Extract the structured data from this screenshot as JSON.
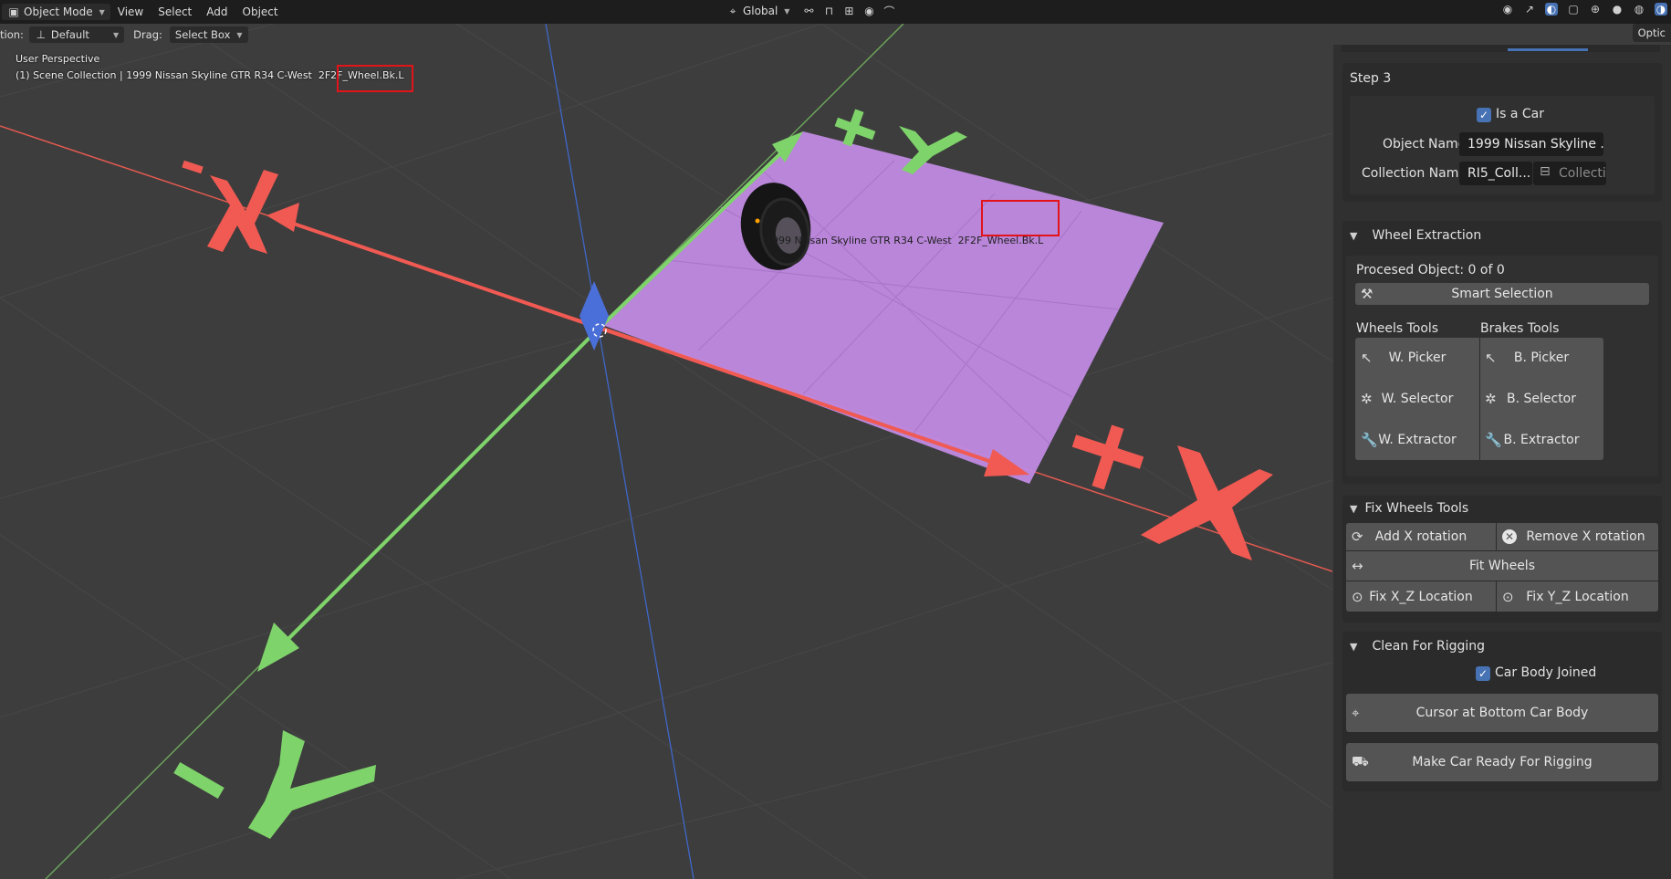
{
  "header": {
    "mode": "Object Mode",
    "menus": [
      "View",
      "Select",
      "Add",
      "Object"
    ],
    "transform_orientation": "Global"
  },
  "toolrow": {
    "orientation_label": "tion:",
    "orientation_value": "Default",
    "drag_label": "Drag:",
    "drag_value": "Select Box",
    "options_tab": "Optic"
  },
  "viewport": {
    "perspective": "User Perspective",
    "collection_path": "(1) Scene Collection | 1999 Nissan Skyline GTR R34 C-West  2F2F_Wheel.Bk.L",
    "object_label": "1999 Nissan Skyline GTR R34 C-West  2F2F_Wheel.Bk.L",
    "axis_labels": {
      "neg_x": "-X",
      "pos_x": "+X",
      "pos_y": "+Y",
      "neg_y": "-Y"
    },
    "colors": {
      "x_axis": "#f05a52",
      "y_axis": "#7fd36b",
      "z_axis": "#4a6fd8",
      "plane": "#c08ae2",
      "highlight": "#e3131a"
    }
  },
  "npanel": {
    "step_title": "Step 3",
    "is_car_label": "Is a Car",
    "object_name_label": "Object Name",
    "object_name_value": "1999 Nissan Skyline ...",
    "collection_name_label": "Collection Name",
    "collection_name_value": "RI5_Coll...",
    "collection_placeholder": "Collecti",
    "wheel_extraction": {
      "title": "Wheel Extraction",
      "processed": "Procesed Object: 0 of 0",
      "smart_selection": "Smart Selection",
      "wheels_tools": "Wheels Tools",
      "brakes_tools": "Brakes Tools",
      "w_picker": "W. Picker",
      "b_picker": "B. Picker",
      "w_selector": "W. Selector",
      "b_selector": "B. Selector",
      "w_extractor": "W. Extractor",
      "b_extractor": "B. Extractor"
    },
    "fix_wheels": {
      "title": "Fix Wheels Tools",
      "add_x": "Add X rotation",
      "remove_x": "Remove X rotation",
      "fit": "Fit Wheels",
      "fix_xz": "Fix X_Z Location",
      "fix_yz": "Fix Y_Z Location"
    },
    "clean_rigging": {
      "title": "Clean For Rigging",
      "car_body_joined": "Car Body Joined",
      "cursor_bottom": "Cursor at Bottom Car Body",
      "make_ready": "Make Car Ready For Rigging"
    }
  }
}
